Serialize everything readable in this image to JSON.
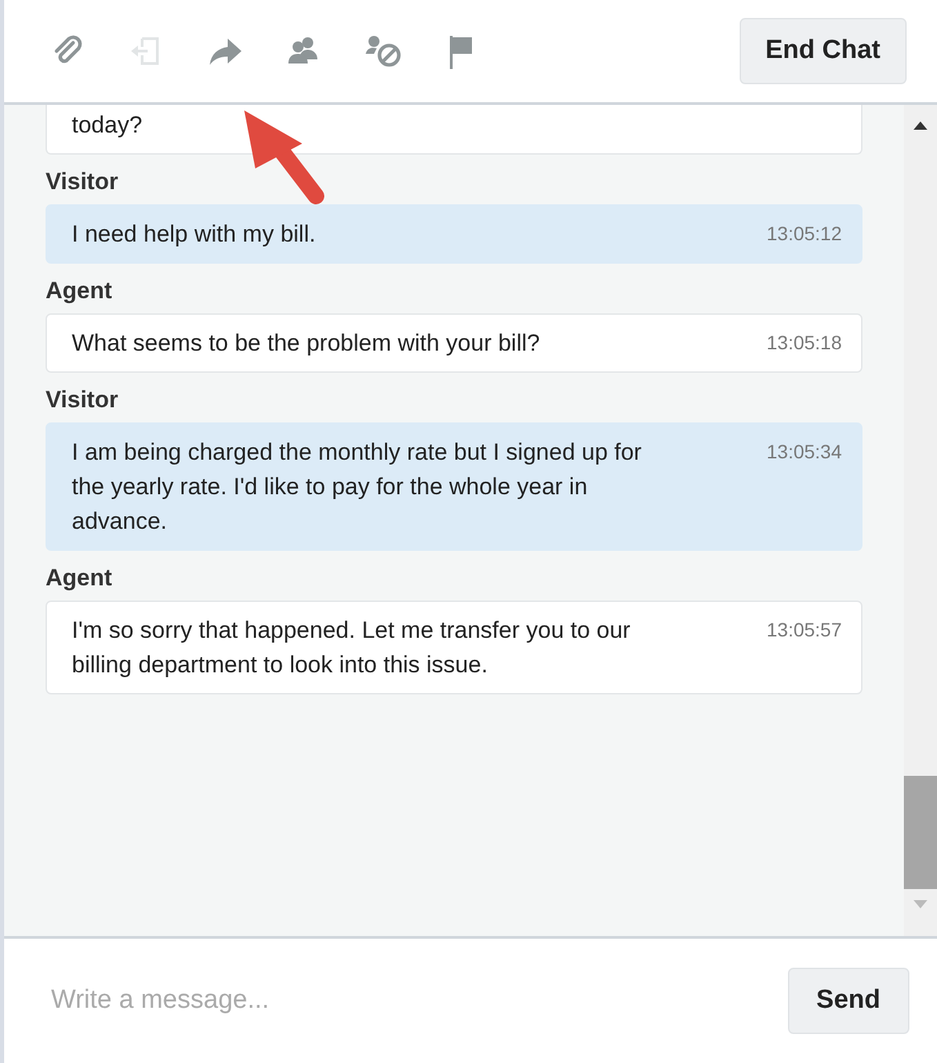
{
  "toolbar": {
    "tools": [
      {
        "kind": "attach",
        "disabled": false
      },
      {
        "kind": "leave",
        "disabled": true
      },
      {
        "kind": "transfer",
        "disabled": false
      },
      {
        "kind": "conference",
        "disabled": false
      },
      {
        "kind": "block",
        "disabled": false
      },
      {
        "kind": "flag",
        "disabled": false
      }
    ],
    "end_button": "End Chat"
  },
  "messages": [
    {
      "kind": "agent",
      "text": "today?"
    },
    {
      "sender": "Visitor",
      "kind": "visitor",
      "text": "I need help with my bill.",
      "time": "13:05:12"
    },
    {
      "sender": "Agent",
      "kind": "agent",
      "text": "What seems to be the problem with your bill?",
      "time": "13:05:18"
    },
    {
      "sender": "Visitor",
      "kind": "visitor",
      "text": "I am being charged the monthly rate but I signed up for the yearly rate. I'd like to pay for the whole year in advance.",
      "time": "13:05:34"
    },
    {
      "sender": "Agent",
      "kind": "agent",
      "text": "I'm so sorry that happened. Let me transfer you to our billing department to look into this issue.",
      "time": "13:05:57"
    }
  ],
  "composer": {
    "placeholder": "Write a message...",
    "send_button": "Send"
  }
}
